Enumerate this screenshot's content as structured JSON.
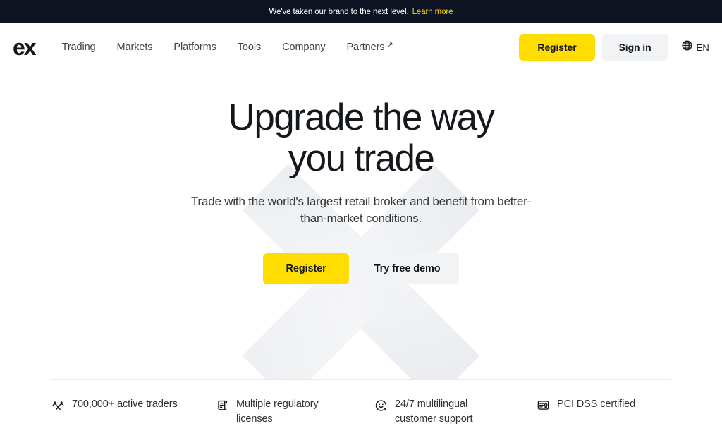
{
  "announcement": {
    "text": "We've taken our brand to the next level.",
    "link_label": "Learn more",
    "background": "#0d1321",
    "link_color": "#ffd400"
  },
  "header": {
    "logo": "ex",
    "nav": [
      {
        "label": "Trading",
        "external": false
      },
      {
        "label": "Markets",
        "external": false
      },
      {
        "label": "Platforms",
        "external": false
      },
      {
        "label": "Tools",
        "external": false
      },
      {
        "label": "Company",
        "external": false
      },
      {
        "label": "Partners",
        "external": true
      }
    ],
    "register_label": "Register",
    "signin_label": "Sign in",
    "language": "EN",
    "accent_color": "#ffdd00"
  },
  "hero": {
    "title_line1": "Upgrade the way",
    "title_line2": "you trade",
    "subtitle": "Trade with the world's largest retail broker and benefit from better-than-market conditions.",
    "register_label": "Register",
    "demo_label": "Try free demo"
  },
  "features": [
    {
      "icon": "users-group-icon",
      "label": "700,000+ active traders"
    },
    {
      "icon": "scroll-document-icon",
      "label": "Multiple regulatory licenses"
    },
    {
      "icon": "smiley-support-icon",
      "label": "24/7 multilingual customer support"
    },
    {
      "icon": "certificate-icon",
      "label": "PCI DSS certified"
    }
  ]
}
